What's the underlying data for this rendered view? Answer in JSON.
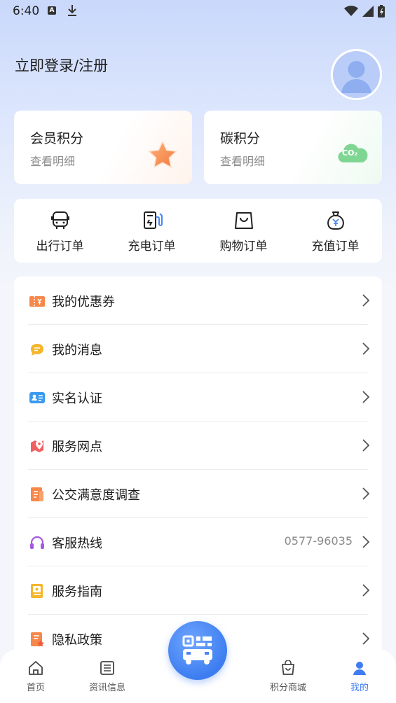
{
  "status_bar": {
    "time": "6:40",
    "a_icon": "A"
  },
  "header": {
    "login_text": "立即登录/注册"
  },
  "points": {
    "member": {
      "title": "会员积分",
      "subtitle": "查看明细"
    },
    "carbon": {
      "title": "碳积分",
      "subtitle": "查看明细",
      "badge": "CO₂"
    }
  },
  "orders": [
    {
      "label": "出行订单",
      "icon": "bus-icon"
    },
    {
      "label": "充电订单",
      "icon": "charging-station-icon"
    },
    {
      "label": "购物订单",
      "icon": "shopping-bag-icon"
    },
    {
      "label": "充值订单",
      "icon": "money-bag-icon"
    }
  ],
  "menu": [
    {
      "label": "我的优惠券",
      "value": "",
      "icon": "coupon-icon"
    },
    {
      "label": "我的消息",
      "value": "",
      "icon": "message-icon"
    },
    {
      "label": "实名认证",
      "value": "",
      "icon": "id-card-icon"
    },
    {
      "label": "服务网点",
      "value": "",
      "icon": "map-pin-icon"
    },
    {
      "label": "公交满意度调查",
      "value": "",
      "icon": "survey-icon"
    },
    {
      "label": "客服热线",
      "value": "0577-96035",
      "icon": "headset-icon"
    },
    {
      "label": "服务指南",
      "value": "",
      "icon": "guide-icon"
    },
    {
      "label": "隐私政策",
      "value": "",
      "icon": "privacy-icon"
    }
  ],
  "tabs": [
    {
      "label": "首页",
      "icon": "home-icon",
      "active": false
    },
    {
      "label": "资讯信息",
      "icon": "news-icon",
      "active": false
    },
    {
      "label": "积分商城",
      "icon": "mall-icon",
      "active": false
    },
    {
      "label": "我的",
      "icon": "person-icon",
      "active": true
    }
  ],
  "colors": {
    "accent": "#3f7cf2",
    "background": "#f4f6fb",
    "header_tint": "#c9d8fb"
  }
}
